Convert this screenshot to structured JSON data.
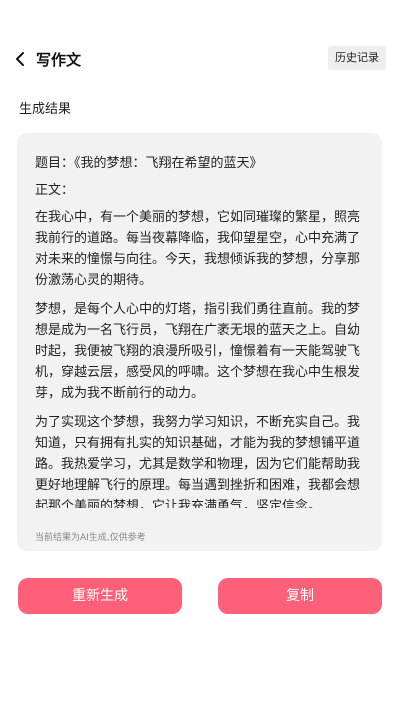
{
  "header": {
    "title": "写作文",
    "history_label": "历史记录"
  },
  "section_label": "生成结果",
  "result": {
    "title_line": "题目：《我的梦想：飞翔在希望的蓝天》",
    "body_label": "正文：",
    "paragraphs": [
      "在我心中，有一个美丽的梦想，它如同璀璨的繁星，照亮我前行的道路。每当夜幕降临，我仰望星空，心中充满了对未来的憧憬与向往。今天，我想倾诉我的梦想，分享那份激荡心灵的期待。",
      "梦想，是每个人心中的灯塔，指引我们勇往直前。我的梦想是成为一名飞行员，飞翔在广袤无垠的蓝天之上。自幼时起，我便被飞翔的浪漫所吸引，憧憬着有一天能驾驶飞机，穿越云层，感受风的呼啸。这个梦想在我心中生根发芽，成为我不断前行的动力。",
      "为了实现这个梦想，我努力学习知识，不断充实自己。我知道，只有拥有扎实的知识基础，才能为我的梦想铺平道路。我热爱学习，尤其是数学和物理，因为它们能帮助我更好地理解飞行的原理。每当遇到挫折和困难，我都会想起那个美丽的梦想，它让我充满勇气，坚定信念。"
    ],
    "disclaimer": "当前结果为AI生成,仅供参考"
  },
  "actions": {
    "regenerate_label": "重新生成",
    "copy_label": "复制"
  },
  "colors": {
    "accent": "#ff6079",
    "card_bg": "#f2f2f2",
    "history_bg": "#eeeeee"
  },
  "icons": {
    "back": "chevron-left-icon"
  }
}
